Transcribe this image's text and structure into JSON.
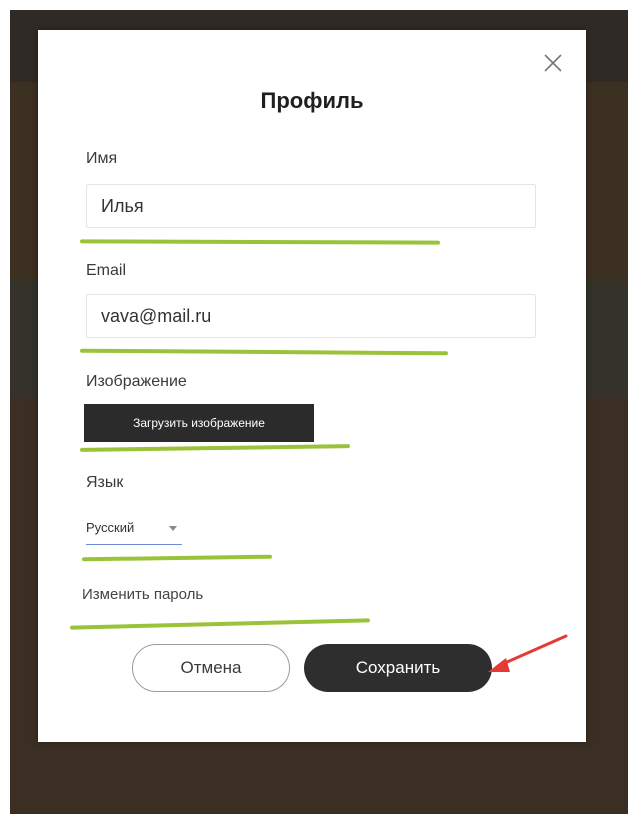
{
  "modal": {
    "title": "Профиль",
    "close_icon": "close-icon",
    "name_label": "Имя",
    "name_value": "Илья",
    "email_label": "Email",
    "email_value": "vava@mail.ru",
    "image_label": "Изображение",
    "upload_button_label": "Загрузить изображение",
    "language_label": "Язык",
    "language_value": "Русский",
    "change_password_link": "Изменить пароль",
    "cancel_button_label": "Отмена",
    "save_button_label": "Сохранить"
  },
  "annotations": {
    "highlight_color": "#9ac33a",
    "arrow_color": "#e53935"
  },
  "colors": {
    "button_dark": "#2e2e2e",
    "background_overlay": "#3a2f22"
  }
}
